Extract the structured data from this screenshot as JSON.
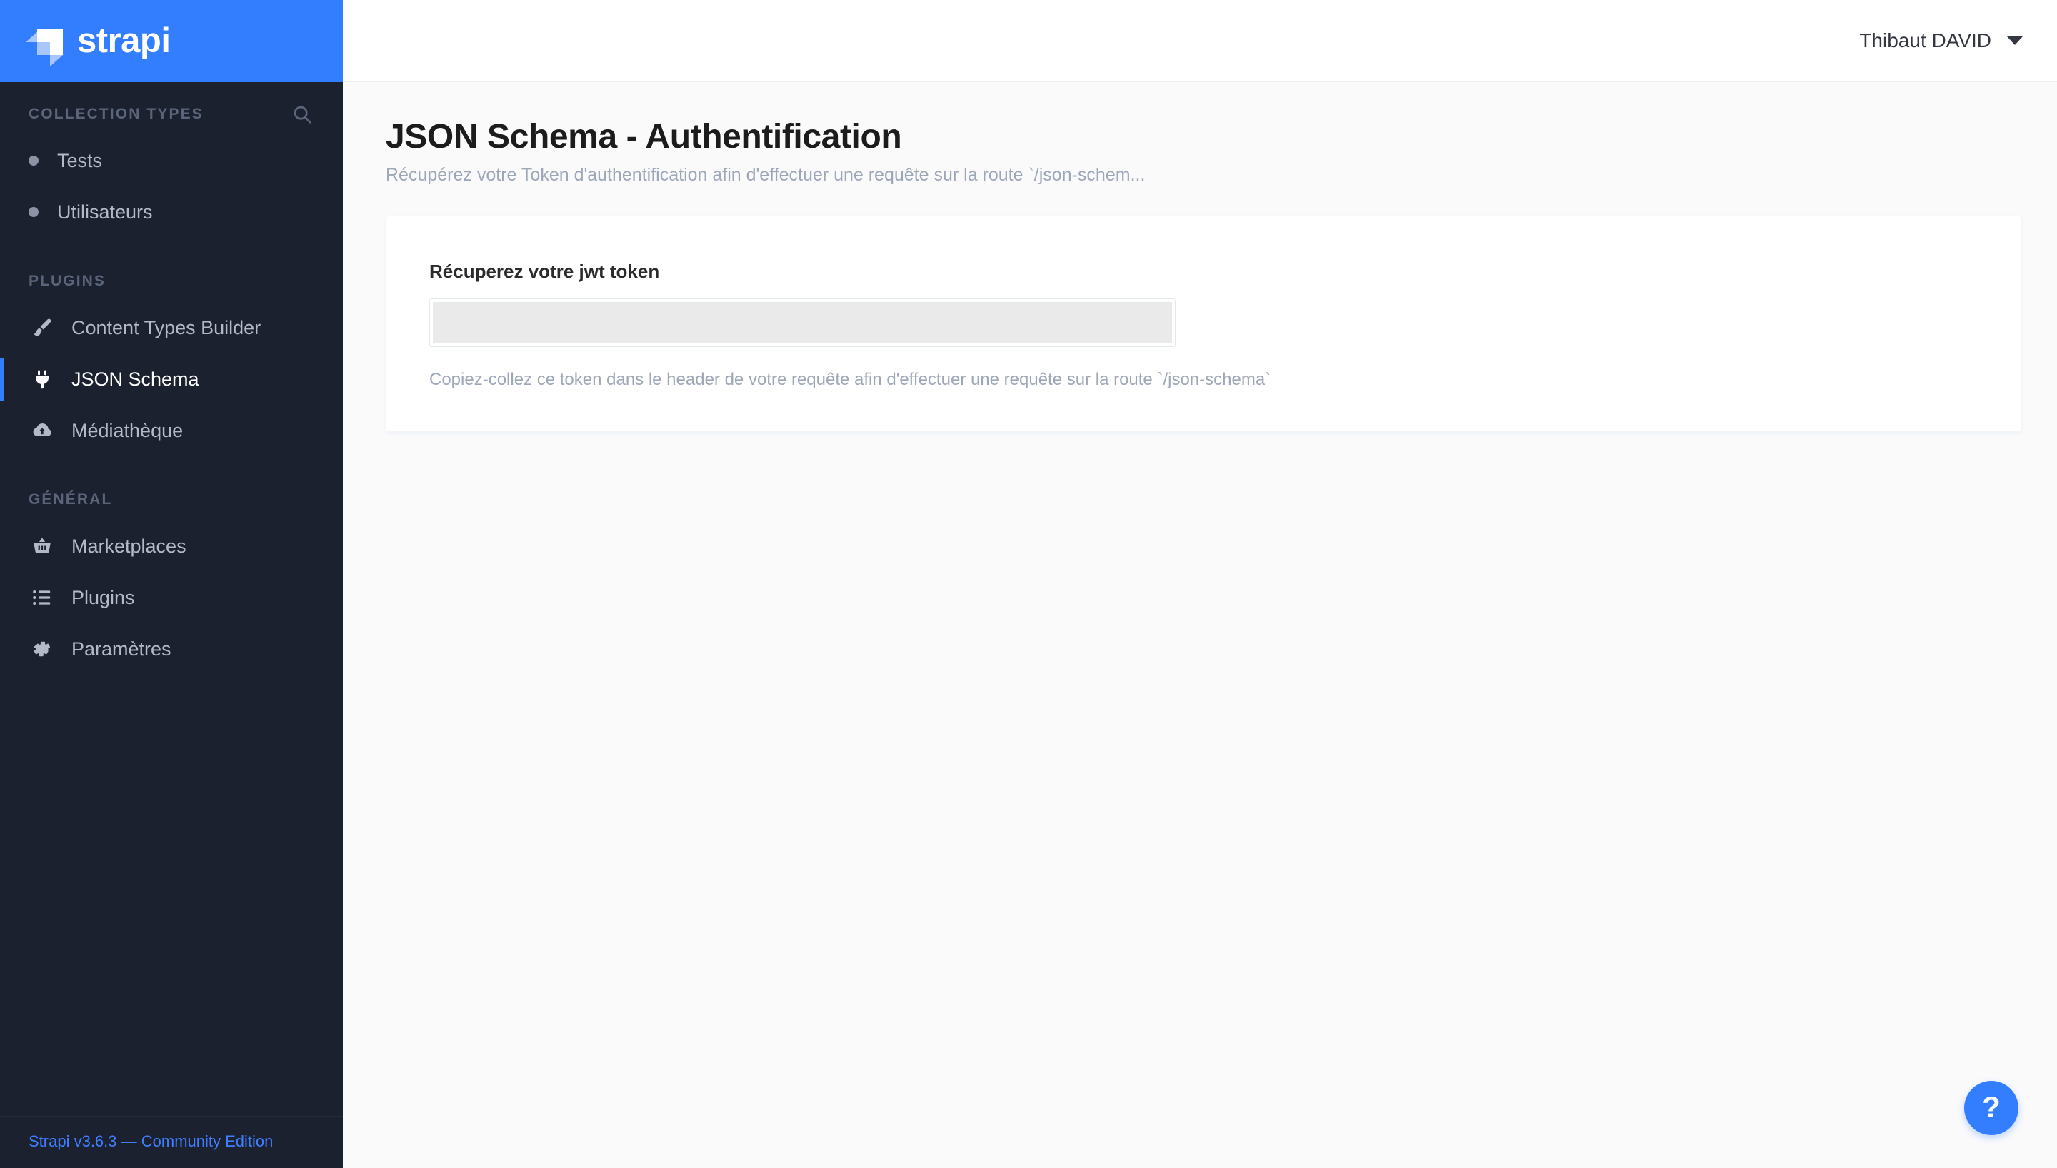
{
  "brand": {
    "name": "strapi",
    "logo_icon": "strapi-logo-icon",
    "accent_color": "#337eff"
  },
  "sidebar": {
    "background_color": "#1c2130",
    "sections": [
      {
        "title": "COLLECTION TYPES",
        "has_search": true,
        "search_icon": "search-icon",
        "items": [
          {
            "label": "Tests",
            "icon": "bullet-icon",
            "active": false
          },
          {
            "label": "Utilisateurs",
            "icon": "bullet-icon",
            "active": false
          }
        ]
      },
      {
        "title": "PLUGINS",
        "has_search": false,
        "items": [
          {
            "label": "Content Types Builder",
            "icon": "paint-brush-icon",
            "active": false
          },
          {
            "label": "JSON Schema",
            "icon": "plug-icon",
            "active": true
          },
          {
            "label": "Médiathèque",
            "icon": "cloud-upload-icon",
            "active": false
          }
        ]
      },
      {
        "title": "GÉNÉRAL",
        "has_search": false,
        "items": [
          {
            "label": "Marketplaces",
            "icon": "shopping-basket-icon",
            "active": false
          },
          {
            "label": "Plugins",
            "icon": "list-icon",
            "active": false
          },
          {
            "label": "Paramètres",
            "icon": "gear-icon",
            "active": false
          }
        ]
      }
    ],
    "footer": {
      "version_label": "Strapi v3.6.3 — Community Edition",
      "version_color": "#3f7fff"
    }
  },
  "topbar": {
    "user_name": "Thibaut DAVID",
    "caret_icon": "chevron-down-icon"
  },
  "page": {
    "title": "JSON Schema - Authentification",
    "subtitle": "Récupérez votre Token d'authentification afin d'effectuer une requête sur la route `/json-schem...",
    "card": {
      "field_label": "Récuperez votre jwt token",
      "token_value": "",
      "token_placeholder": "",
      "help_text": "Copiez-collez ce token dans le header de votre requête afin d'effectuer une requête sur la route `/json-schema`"
    }
  },
  "help_fab": {
    "glyph": "?",
    "icon": "question-mark-icon",
    "color": "#337eff"
  }
}
